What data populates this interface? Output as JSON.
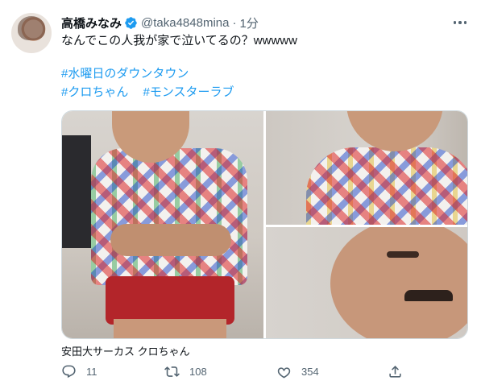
{
  "tweet": {
    "display_name": "高橋みなみ",
    "handle": "@taka4848mina",
    "separator": "·",
    "time": "1分",
    "text": "なんでこの人我が家で泣いてるの？wwwww",
    "hashtags": [
      "#水曜日のダウンタウン",
      "#クロちゃん",
      "#モンスターラブ"
    ],
    "media_caption": "安田大サーカス クロちゃん"
  },
  "icons": {
    "verified": "verified-badge-icon",
    "more": "more-options-icon",
    "reply": "reply-icon",
    "retweet": "retweet-icon",
    "like": "like-icon",
    "share": "share-icon"
  },
  "actions": {
    "reply_count": "11",
    "retweet_count": "108",
    "like_count": "354"
  },
  "colors": {
    "link": "#1d9bf0",
    "verified": "#1d9bf0",
    "secondary_text": "#536471"
  }
}
